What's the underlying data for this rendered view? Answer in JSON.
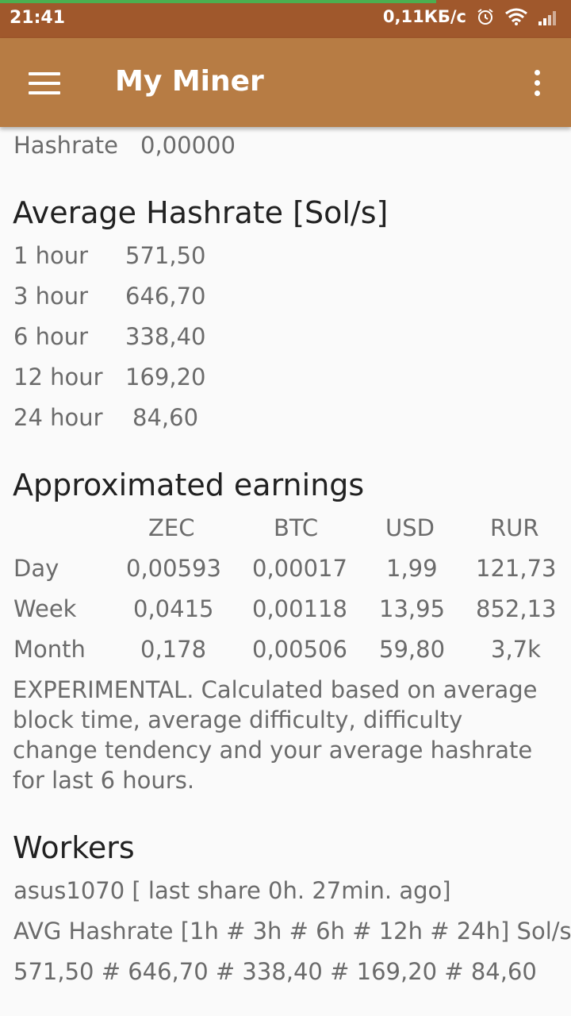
{
  "status_bar": {
    "time": "21:41",
    "speed": "0,11КБ/с"
  },
  "app_bar": {
    "title": "My Miner"
  },
  "hashrate": {
    "label": "Hashrate",
    "value": "0,00000"
  },
  "average": {
    "title": "Average Hashrate [Sol/s]",
    "rows": [
      {
        "label": "1 hour",
        "value": "571,50"
      },
      {
        "label": "3 hour",
        "value": "646,70"
      },
      {
        "label": "6 hour",
        "value": "338,40"
      },
      {
        "label": "12 hour",
        "value": "169,20"
      },
      {
        "label": "24 hour",
        "value": "84,60"
      }
    ]
  },
  "earnings": {
    "title": "Approximated earnings",
    "headers": [
      "ZEC",
      "BTC",
      "USD",
      "RUR"
    ],
    "rows": [
      {
        "label": "Day",
        "values": [
          "0,00593",
          "0,00017",
          "1,99",
          "121,73"
        ]
      },
      {
        "label": "Week",
        "values": [
          "0,0415",
          "0,00118",
          "13,95",
          "852,13"
        ]
      },
      {
        "label": "Month",
        "values": [
          "0,178",
          "0,00506",
          "59,80",
          "3,7k"
        ]
      }
    ],
    "note": "EXPERIMENTAL. Calculated based on average block time, average difficulty, difficulty change tendency and your average hashrate for last 6 hours."
  },
  "workers": {
    "title": "Workers",
    "name_line": "asus1070 [ last share 0h. 27min. ago]",
    "avg_label": "AVG Hashrate [1h # 3h # 6h # 12h # 24h] Sol/s",
    "avg_values": "571,50 # 646,70 # 338,40 # 169,20 # 84,60"
  }
}
